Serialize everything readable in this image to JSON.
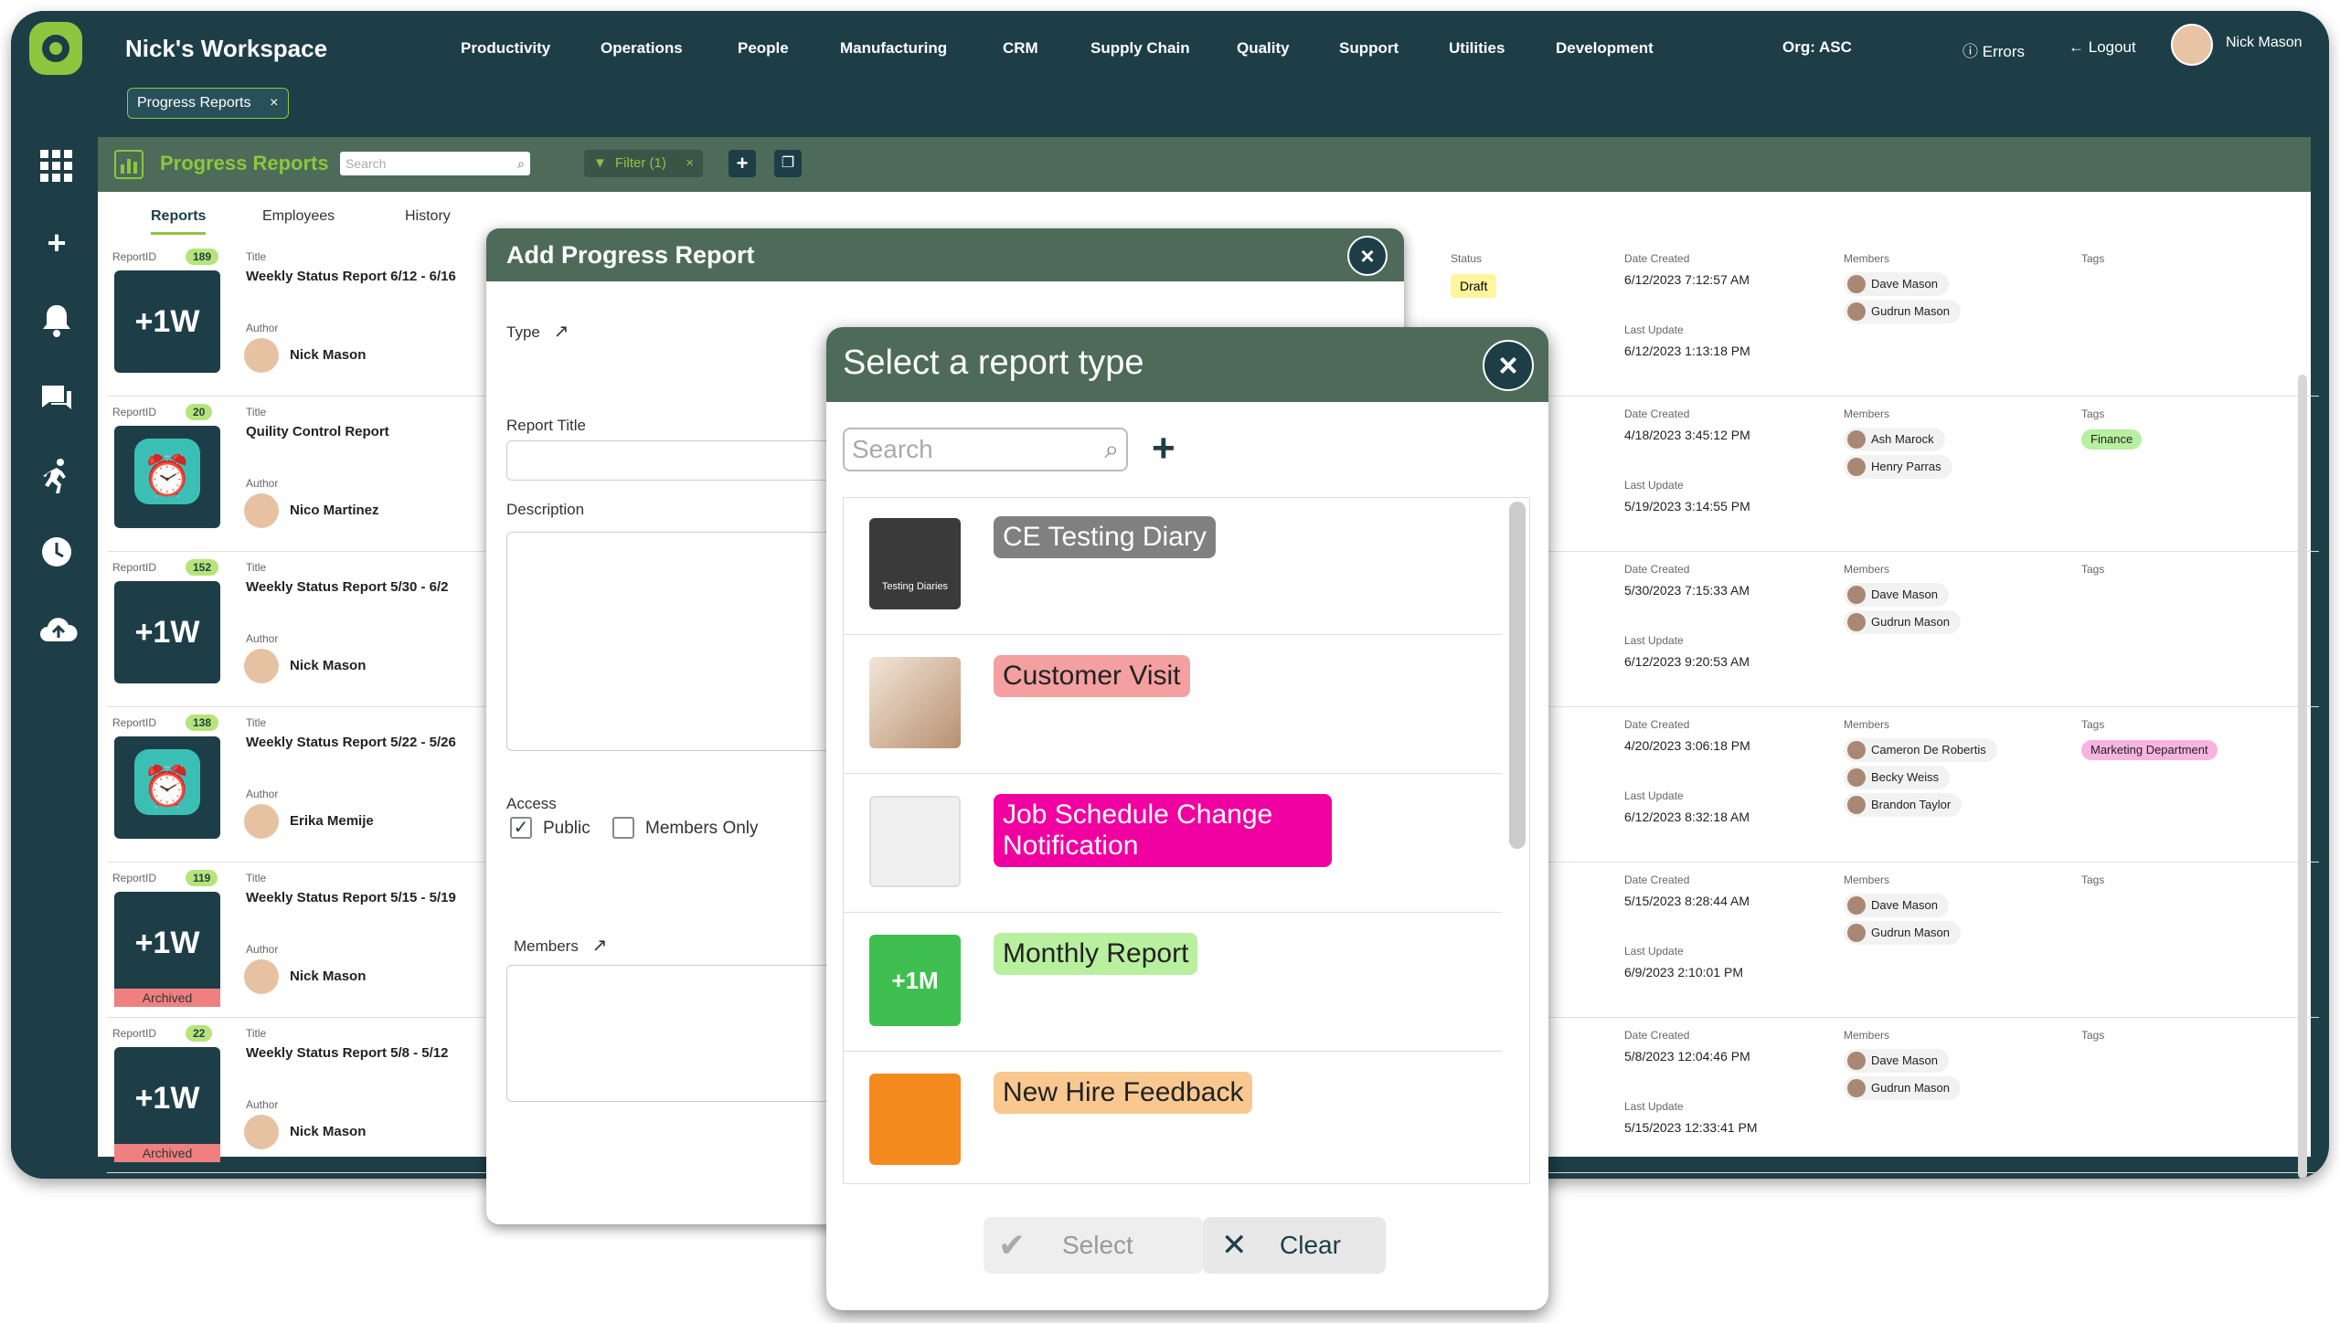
{
  "workspace": "Nick's Workspace",
  "nav": [
    "Productivity",
    "Operations",
    "People",
    "Manufacturing",
    "CRM",
    "Supply Chain",
    "Quality",
    "Support",
    "Utilities",
    "Development"
  ],
  "org": "Org:  ASC",
  "top_right": {
    "errors": "Errors",
    "logout": "Logout",
    "user": "Nick Mason"
  },
  "open_tab": "Progress Reports",
  "toolbar": {
    "title": "Progress Reports",
    "search_placeholder": "Search",
    "filter": "Filter (1)"
  },
  "subtabs": [
    "Reports",
    "Employees",
    "History"
  ],
  "labels": {
    "reportid": "ReportID",
    "title": "Title",
    "author": "Author",
    "status": "Status",
    "date_created": "Date Created",
    "last_update": "Last Update",
    "members": "Members",
    "tags": "Tags",
    "archived": "Archived"
  },
  "reports": [
    {
      "id": "189",
      "title": "Weekly Status Report 6/12 - 6/16",
      "author": "Nick Mason",
      "thumb": "+1W",
      "status": "Draft",
      "created": "6/12/2023 7:12:57 AM",
      "updated": "6/12/2023 1:13:18 PM",
      "members": [
        "Dave Mason",
        "Gudrun Mason"
      ],
      "tags": []
    },
    {
      "id": "20",
      "title": "Quility Control Report",
      "author": "Nico Martinez",
      "thumb": "",
      "status": "",
      "created": "4/18/2023 3:45:12 PM",
      "updated": "5/19/2023 3:14:55 PM",
      "members": [
        "Ash Marock",
        "Henry Parras"
      ],
      "tags": [
        "Finance"
      ]
    },
    {
      "id": "152",
      "title": "Weekly Status Report 5/30 - 6/2",
      "author": "Nick Mason",
      "thumb": "+1W",
      "status": "",
      "created": "5/30/2023 7:15:33 AM",
      "updated": "6/12/2023 9:20:53 AM",
      "members": [
        "Dave Mason",
        "Gudrun Mason"
      ],
      "tags": []
    },
    {
      "id": "138",
      "title": "Weekly Status Report 5/22 - 5/26",
      "author": "Erika Memije",
      "thumb": "",
      "status": "",
      "created": "4/20/2023 3:06:18 PM",
      "updated": "6/12/2023 8:32:18 AM",
      "members": [
        "Cameron De Robertis",
        "Becky Weiss",
        "Brandon Taylor"
      ],
      "tags": [
        "Marketing Department"
      ]
    },
    {
      "id": "119",
      "title": "Weekly Status Report 5/15 - 5/19",
      "author": "Nick Mason",
      "thumb": "+1W",
      "status": "",
      "created": "5/15/2023 8:28:44 AM",
      "updated": "6/9/2023 2:10:01 PM",
      "members": [
        "Dave Mason",
        "Gudrun Mason"
      ],
      "tags": []
    },
    {
      "id": "22",
      "title": "Weekly Status Report 5/8 - 5/12",
      "author": "Nick Mason",
      "thumb": "+1W",
      "status": "",
      "created": "5/8/2023 12:04:46 PM",
      "updated": "5/15/2023 12:33:41 PM",
      "members": [
        "Dave Mason",
        "Gudrun Mason"
      ],
      "tags": []
    }
  ],
  "add_modal": {
    "title": "Add Progress Report",
    "type": "Type",
    "report_title": "Report Title",
    "description": "Description",
    "access": "Access",
    "public": "Public",
    "members_only": "Members Only",
    "members": "Members"
  },
  "select_modal": {
    "title": "Select a report type",
    "search_placeholder": "Search",
    "types": [
      {
        "label": "CE Testing Diary",
        "color": "#808080",
        "img_text": "Testing Diaries"
      },
      {
        "label": "Customer Visit",
        "color": "#f4a0a0",
        "img_text": ""
      },
      {
        "label": "Job Schedule Change Notification",
        "color": "#f000a0",
        "img_text": ""
      },
      {
        "label": "Monthly Report",
        "color": "#b8f0a0",
        "img_text": "+1M"
      },
      {
        "label": "New Hire Feedback",
        "color": "#f8c890",
        "img_text": ""
      }
    ],
    "select": "Select",
    "clear": "Clear"
  },
  "colors": {
    "brand_dark": "#1d3e47",
    "brand_green": "#8dc63f",
    "header_green": "#4d6b58"
  }
}
